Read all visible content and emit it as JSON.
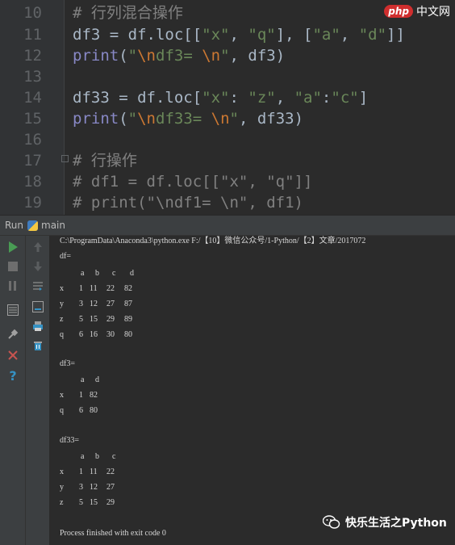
{
  "editor": {
    "lines": [
      {
        "num": "10",
        "parts": [
          {
            "t": "# 行列混合操作",
            "c": "kw-comment"
          }
        ]
      },
      {
        "num": "11",
        "parts": [
          {
            "t": "df3 = df.loc[[",
            "c": ""
          },
          {
            "t": "\"x\"",
            "c": "kw-str"
          },
          {
            "t": ", ",
            "c": ""
          },
          {
            "t": "\"q\"",
            "c": "kw-str"
          },
          {
            "t": "], [",
            "c": ""
          },
          {
            "t": "\"a\"",
            "c": "kw-str"
          },
          {
            "t": ", ",
            "c": ""
          },
          {
            "t": "\"d\"",
            "c": "kw-str"
          },
          {
            "t": "]]",
            "c": ""
          }
        ]
      },
      {
        "num": "12",
        "parts": [
          {
            "t": "print",
            "c": "kw-fn"
          },
          {
            "t": "(",
            "c": ""
          },
          {
            "t": "\"",
            "c": "kw-str"
          },
          {
            "t": "\\n",
            "c": "kw-esc"
          },
          {
            "t": "df3= ",
            "c": "kw-str"
          },
          {
            "t": "\\n",
            "c": "kw-esc"
          },
          {
            "t": "\"",
            "c": "kw-str"
          },
          {
            "t": ", df3)",
            "c": ""
          }
        ]
      },
      {
        "num": "13",
        "parts": []
      },
      {
        "num": "14",
        "parts": [
          {
            "t": "df33 = df.loc[",
            "c": ""
          },
          {
            "t": "\"x\"",
            "c": "kw-str"
          },
          {
            "t": ": ",
            "c": ""
          },
          {
            "t": "\"z\"",
            "c": "kw-str"
          },
          {
            "t": ", ",
            "c": ""
          },
          {
            "t": "\"a\"",
            "c": "kw-str"
          },
          {
            "t": ":",
            "c": ""
          },
          {
            "t": "\"c\"",
            "c": "kw-str"
          },
          {
            "t": "]",
            "c": ""
          }
        ]
      },
      {
        "num": "15",
        "parts": [
          {
            "t": "print",
            "c": "kw-fn"
          },
          {
            "t": "(",
            "c": ""
          },
          {
            "t": "\"",
            "c": "kw-str"
          },
          {
            "t": "\\n",
            "c": "kw-esc"
          },
          {
            "t": "df33= ",
            "c": "kw-str"
          },
          {
            "t": "\\n",
            "c": "kw-esc"
          },
          {
            "t": "\"",
            "c": "kw-str"
          },
          {
            "t": ", df33)",
            "c": ""
          }
        ]
      },
      {
        "num": "16",
        "parts": []
      },
      {
        "num": "17",
        "parts": [
          {
            "t": "# 行操作",
            "c": "kw-comment"
          }
        ]
      },
      {
        "num": "18",
        "parts": [
          {
            "t": "# df1 = df.loc[[\"x\", \"q\"]]",
            "c": "kw-comment"
          }
        ]
      },
      {
        "num": "19",
        "parts": [
          {
            "t": "# print(\"\\ndf1= \\n\", df1)",
            "c": "kw-comment"
          }
        ]
      }
    ]
  },
  "watermark_top": {
    "badge": "php",
    "text": "中文网"
  },
  "run_tab": {
    "run_label": "Run",
    "config_name": "main"
  },
  "console": {
    "command": "C:\\ProgramData\\Anaconda3\\python.exe F:/【10】微信公众号/1-Python/【2】文章/2017072",
    "df": {
      "label": "df=",
      "columns": [
        "a",
        "b",
        "c",
        "d"
      ],
      "rows": [
        {
          "index": "x",
          "values": [
            "1",
            "11",
            "22",
            "82"
          ]
        },
        {
          "index": "y",
          "values": [
            "3",
            "12",
            "27",
            "87"
          ]
        },
        {
          "index": "z",
          "values": [
            "5",
            "15",
            "29",
            "89"
          ]
        },
        {
          "index": "q",
          "values": [
            "6",
            "16",
            "30",
            "80"
          ]
        }
      ]
    },
    "df3": {
      "label": "df3=",
      "columns": [
        "a",
        "d"
      ],
      "rows": [
        {
          "index": "x",
          "values": [
            "1",
            "82"
          ]
        },
        {
          "index": "q",
          "values": [
            "6",
            "80"
          ]
        }
      ]
    },
    "df33": {
      "label": "df33=",
      "columns": [
        "a",
        "b",
        "c"
      ],
      "rows": [
        {
          "index": "x",
          "values": [
            "1",
            "11",
            "22"
          ]
        },
        {
          "index": "y",
          "values": [
            "3",
            "12",
            "27"
          ]
        },
        {
          "index": "z",
          "values": [
            "5",
            "15",
            "29"
          ]
        }
      ]
    },
    "exit_message": "Process finished with exit code 0"
  },
  "watermark_bottom": {
    "text": "快乐生活之Python"
  },
  "colors": {
    "run_green": "#499c54",
    "stop_red": "#c75450",
    "help_blue": "#3592c4"
  }
}
